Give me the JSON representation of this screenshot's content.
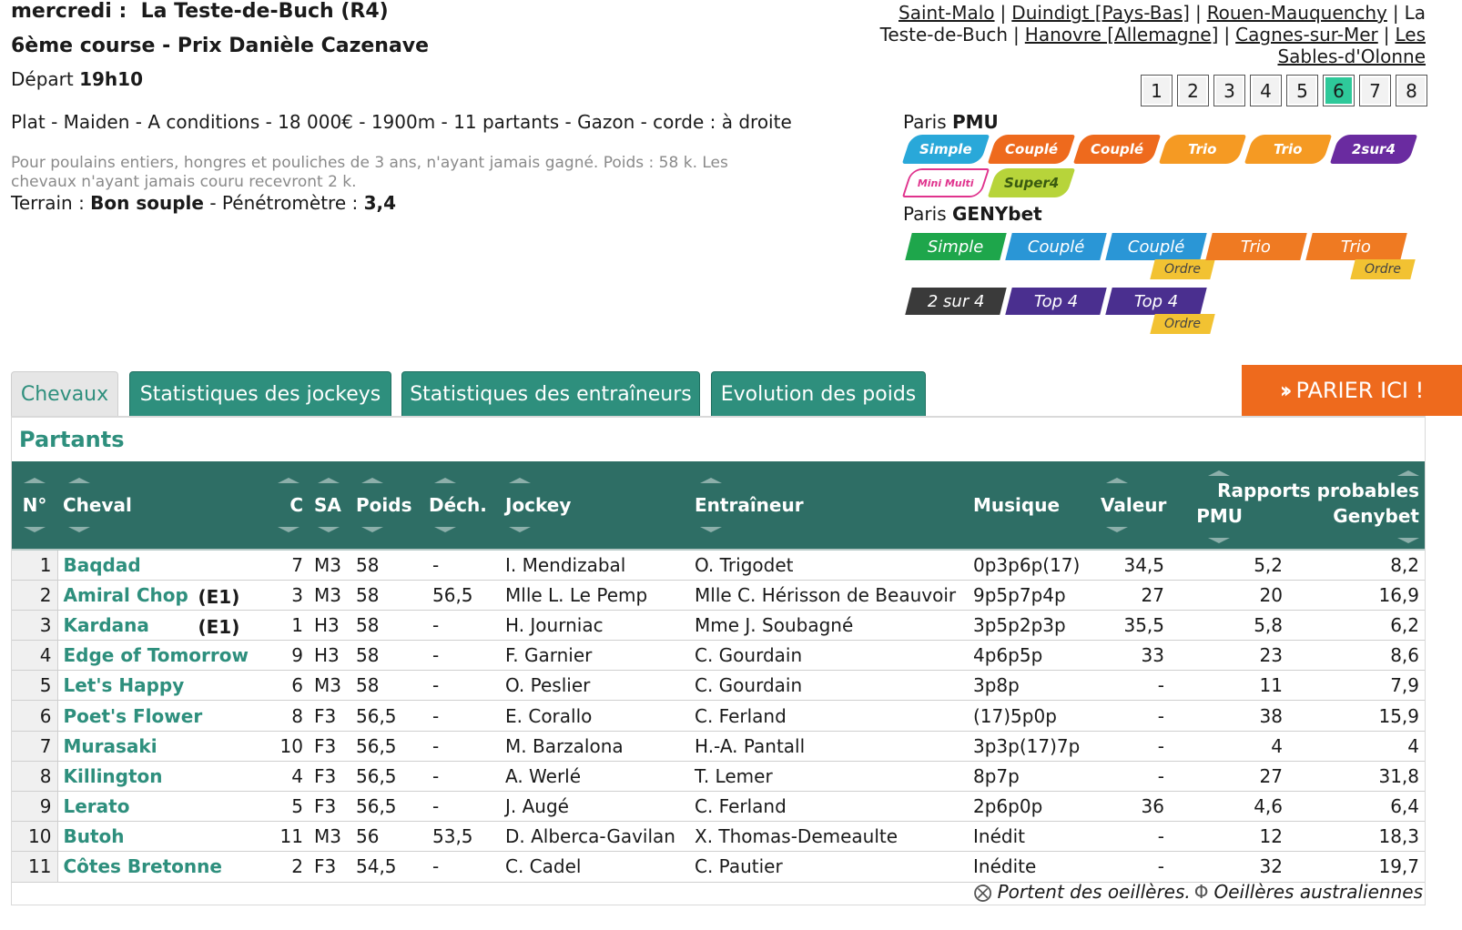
{
  "race": {
    "day": "mercredi :",
    "venue": "La Teste-de-Buch (R4)",
    "course_title": "6ème course - Prix Danièle Cazenave",
    "depart_label": "Départ",
    "depart_time": "19h10",
    "conditions": "Plat - Maiden - A conditions - 18 000€ - 1900m - 11 partants - Gazon - corde : à droite",
    "conditions_note": "Pour poulains entiers, hongres et pouliches de 3 ans, n'ayant jamais gagné. Poids : 58 k. Les chevaux n'ayant jamais couru recevront 2 k.",
    "terrain_label": "Terrain :",
    "terrain_value": "Bon souple",
    "penetro_label": "- Pénétromètre :",
    "penetro_value": "3,4"
  },
  "meetings": {
    "items": [
      "Saint-Malo",
      "Duindigt [Pays-Bas]",
      "Rouen-Mauquenchy",
      "La Teste-de-Buch",
      "Hanovre [Allemagne]",
      "Cagnes-sur-Mer",
      "Les Sables-d'Olonne"
    ],
    "linked": [
      true,
      true,
      true,
      false,
      true,
      true,
      true
    ],
    "separator": "|"
  },
  "race_numbers": {
    "items": [
      "1",
      "2",
      "3",
      "4",
      "5",
      "6",
      "7",
      "8"
    ],
    "active": "6"
  },
  "paris_pmu": {
    "label": "Paris",
    "brand": "PMU",
    "row1": [
      {
        "label": "Simple",
        "color": "#29a8d9"
      },
      {
        "label": "Couplé",
        "color": "#ee6a1d"
      },
      {
        "label": "Couplé",
        "color": "#ee6a1d"
      },
      {
        "label": "Trio",
        "color": "#f59a23"
      },
      {
        "label": "Trio",
        "color": "#f59a23"
      },
      {
        "label": "2sur4",
        "color": "#6a2ba0"
      }
    ],
    "row2": [
      {
        "label": "Mini Multi",
        "color": "#e0338d"
      },
      {
        "label": "Super4",
        "color": "#b7d43a"
      }
    ]
  },
  "paris_geny": {
    "label": "Paris",
    "brand": "GENYbet",
    "ordre_label": "Ordre",
    "row1": [
      {
        "label": "Simple",
        "color": "#1ea64b",
        "ordre": false
      },
      {
        "label": "Couplé",
        "color": "#2a96d6",
        "ordre": false
      },
      {
        "label": "Couplé",
        "color": "#2a96d6",
        "ordre": true
      },
      {
        "label": "Trio",
        "color": "#ef7a22",
        "ordre": false
      },
      {
        "label": "Trio",
        "color": "#ef7a22",
        "ordre": true
      }
    ],
    "row2": [
      {
        "label": "2 sur 4",
        "color": "#3a3a3a",
        "ordre": false
      },
      {
        "label": "Top 4",
        "color": "#4a2f8f",
        "ordre": false
      },
      {
        "label": "Top 4",
        "color": "#4a2f8f",
        "ordre": true
      }
    ]
  },
  "tabs": [
    "Chevaux",
    "Statistiques des jockeys",
    "Statistiques des entraîneurs",
    "Evolution des poids"
  ],
  "parier_label": "PARIER ICI !",
  "partants_title": "Partants",
  "table": {
    "headers": {
      "num": "N°",
      "cheval": "Cheval",
      "c": "C",
      "sa": "SA",
      "poids": "Poids",
      "dech": "Déch.",
      "jockey": "Jockey",
      "entraineur": "Entraîneur",
      "musique": "Musique",
      "valeur": "Valeur",
      "rapports": "Rapports probables",
      "pmu": "PMU",
      "genybet": "Genybet"
    },
    "rows": [
      {
        "num": "1",
        "name": "Baqdad",
        "ecurie": "",
        "c": "7",
        "sa": "M3",
        "poids": "58",
        "dech": "-",
        "jockey": "I. Mendizabal",
        "trainer": "O. Trigodet",
        "musique": "0p3p6p(17)",
        "valeur": "34,5",
        "pmu": "5,2",
        "geny": "8,2"
      },
      {
        "num": "2",
        "name": "Amiral Chop",
        "ecurie": "(E1)",
        "c": "3",
        "sa": "M3",
        "poids": "58",
        "dech": "56,5",
        "jockey": "Mlle L. Le Pemp",
        "trainer": "Mlle C. Hérisson de Beauvoir",
        "musique": "9p5p7p4p",
        "valeur": "27",
        "pmu": "20",
        "geny": "16,9"
      },
      {
        "num": "3",
        "name": "Kardana",
        "ecurie": "(E1)",
        "c": "1",
        "sa": "H3",
        "poids": "58",
        "dech": "-",
        "jockey": "H. Journiac",
        "trainer": "Mme J. Soubagné",
        "musique": "3p5p2p3p",
        "valeur": "35,5",
        "pmu": "5,8",
        "geny": "6,2"
      },
      {
        "num": "4",
        "name": "Edge of Tomorrow",
        "ecurie": "",
        "c": "9",
        "sa": "H3",
        "poids": "58",
        "dech": "-",
        "jockey": "F. Garnier",
        "trainer": "C. Gourdain",
        "musique": "4p6p5p",
        "valeur": "33",
        "pmu": "23",
        "geny": "8,6"
      },
      {
        "num": "5",
        "name": "Let's Happy",
        "ecurie": "",
        "c": "6",
        "sa": "M3",
        "poids": "58",
        "dech": "-",
        "jockey": "O. Peslier",
        "trainer": "C. Gourdain",
        "musique": "3p8p",
        "valeur": "-",
        "pmu": "11",
        "geny": "7,9"
      },
      {
        "num": "6",
        "name": "Poet's Flower",
        "ecurie": "",
        "c": "8",
        "sa": "F3",
        "poids": "56,5",
        "dech": "-",
        "jockey": "E. Corallo",
        "trainer": "C. Ferland",
        "musique": "(17)5p0p",
        "valeur": "-",
        "pmu": "38",
        "geny": "15,9"
      },
      {
        "num": "7",
        "name": "Murasaki",
        "ecurie": "",
        "c": "10",
        "sa": "F3",
        "poids": "56,5",
        "dech": "-",
        "jockey": "M. Barzalona",
        "trainer": "H.-A. Pantall",
        "musique": "3p3p(17)7p",
        "valeur": "-",
        "pmu": "4",
        "geny": "4"
      },
      {
        "num": "8",
        "name": "Killington",
        "ecurie": "",
        "c": "4",
        "sa": "F3",
        "poids": "56,5",
        "dech": "-",
        "jockey": "A. Werlé",
        "trainer": "T. Lemer",
        "musique": "8p7p",
        "valeur": "-",
        "pmu": "27",
        "geny": "31,8"
      },
      {
        "num": "9",
        "name": "Lerato",
        "ecurie": "",
        "c": "5",
        "sa": "F3",
        "poids": "56,5",
        "dech": "-",
        "jockey": "J. Augé",
        "trainer": "C. Ferland",
        "musique": "2p6p0p",
        "valeur": "36",
        "pmu": "4,6",
        "geny": "6,4"
      },
      {
        "num": "10",
        "name": "Butoh",
        "ecurie": "",
        "c": "11",
        "sa": "M3",
        "poids": "56",
        "dech": "53,5",
        "jockey": "D. Alberca-Gavilan",
        "trainer": "X. Thomas-Demeaulte",
        "musique": "Inédit",
        "valeur": "-",
        "pmu": "12",
        "geny": "18,3"
      },
      {
        "num": "11",
        "name": "Côtes Bretonne",
        "ecurie": "",
        "c": "2",
        "sa": "F3",
        "poids": "54,5",
        "dech": "-",
        "jockey": "C. Cadel",
        "trainer": "C. Pautier",
        "musique": "Inédite",
        "valeur": "-",
        "pmu": "32",
        "geny": "19,7"
      }
    ]
  },
  "legend": {
    "oeilleres_icon": "⨂",
    "oeilleres": "Portent des oeillères.",
    "australiennes_icon": "Φ",
    "australiennes": "Oeillères australiennes"
  }
}
